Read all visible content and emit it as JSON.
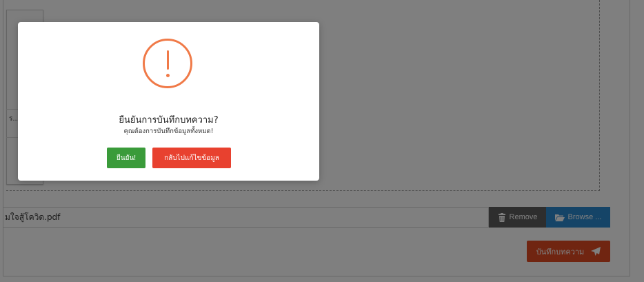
{
  "preview": {
    "caption": "ร..."
  },
  "file_input": {
    "value": "มใจสู้โควิด.pdf"
  },
  "buttons": {
    "remove_label": "Remove",
    "browse_label": "Browse ...",
    "save_label": "บันทึกบทความ"
  },
  "modal": {
    "icon_symbol": "!",
    "title": "ยืนยันการบันทึกบทความ?",
    "text": "คุณต้องการบันทึกข้อมูลทั้งหมด!",
    "confirm_label": "ยืนยัน!",
    "back_label": "กลับไปแก้ไขข้อมูล"
  },
  "icons": {
    "remove": "trash-icon",
    "browse": "folder-open-icon",
    "save": "paper-plane-icon",
    "alert": "exclamation-circle-icon"
  },
  "colors": {
    "alert": "#f07a48",
    "confirm": "#3a9b3a",
    "back": "#e8412f",
    "remove": "#5d5d5d",
    "browse": "#2a88cf",
    "save": "#e04a23"
  }
}
